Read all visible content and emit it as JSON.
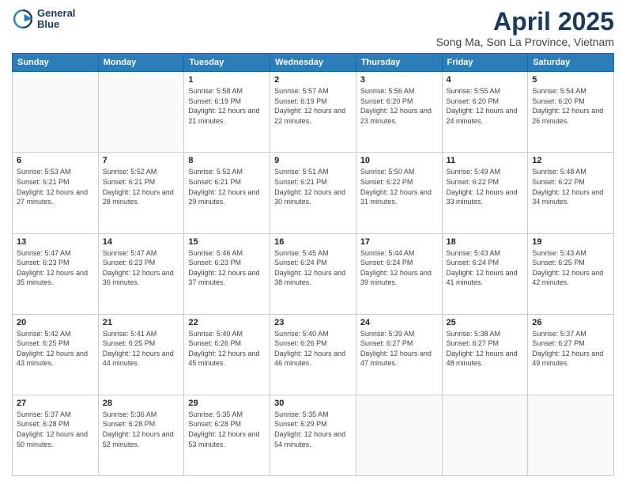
{
  "header": {
    "logo_line1": "General",
    "logo_line2": "Blue",
    "title": "April 2025",
    "subtitle": "Song Ma, Son La Province, Vietnam"
  },
  "days_of_week": [
    "Sunday",
    "Monday",
    "Tuesday",
    "Wednesday",
    "Thursday",
    "Friday",
    "Saturday"
  ],
  "weeks": [
    [
      {
        "num": "",
        "detail": ""
      },
      {
        "num": "",
        "detail": ""
      },
      {
        "num": "1",
        "detail": "Sunrise: 5:58 AM\nSunset: 6:19 PM\nDaylight: 12 hours and 21 minutes."
      },
      {
        "num": "2",
        "detail": "Sunrise: 5:57 AM\nSunset: 6:19 PM\nDaylight: 12 hours and 22 minutes."
      },
      {
        "num": "3",
        "detail": "Sunrise: 5:56 AM\nSunset: 6:20 PM\nDaylight: 12 hours and 23 minutes."
      },
      {
        "num": "4",
        "detail": "Sunrise: 5:55 AM\nSunset: 6:20 PM\nDaylight: 12 hours and 24 minutes."
      },
      {
        "num": "5",
        "detail": "Sunrise: 5:54 AM\nSunset: 6:20 PM\nDaylight: 12 hours and 26 minutes."
      }
    ],
    [
      {
        "num": "6",
        "detail": "Sunrise: 5:53 AM\nSunset: 6:21 PM\nDaylight: 12 hours and 27 minutes."
      },
      {
        "num": "7",
        "detail": "Sunrise: 5:52 AM\nSunset: 6:21 PM\nDaylight: 12 hours and 28 minutes."
      },
      {
        "num": "8",
        "detail": "Sunrise: 5:52 AM\nSunset: 6:21 PM\nDaylight: 12 hours and 29 minutes."
      },
      {
        "num": "9",
        "detail": "Sunrise: 5:51 AM\nSunset: 6:21 PM\nDaylight: 12 hours and 30 minutes."
      },
      {
        "num": "10",
        "detail": "Sunrise: 5:50 AM\nSunset: 6:22 PM\nDaylight: 12 hours and 31 minutes."
      },
      {
        "num": "11",
        "detail": "Sunrise: 5:49 AM\nSunset: 6:22 PM\nDaylight: 12 hours and 33 minutes."
      },
      {
        "num": "12",
        "detail": "Sunrise: 5:48 AM\nSunset: 6:22 PM\nDaylight: 12 hours and 34 minutes."
      }
    ],
    [
      {
        "num": "13",
        "detail": "Sunrise: 5:47 AM\nSunset: 6:23 PM\nDaylight: 12 hours and 35 minutes."
      },
      {
        "num": "14",
        "detail": "Sunrise: 5:47 AM\nSunset: 6:23 PM\nDaylight: 12 hours and 36 minutes."
      },
      {
        "num": "15",
        "detail": "Sunrise: 5:46 AM\nSunset: 6:23 PM\nDaylight: 12 hours and 37 minutes."
      },
      {
        "num": "16",
        "detail": "Sunrise: 5:45 AM\nSunset: 6:24 PM\nDaylight: 12 hours and 38 minutes."
      },
      {
        "num": "17",
        "detail": "Sunrise: 5:44 AM\nSunset: 6:24 PM\nDaylight: 12 hours and 39 minutes."
      },
      {
        "num": "18",
        "detail": "Sunrise: 5:43 AM\nSunset: 6:24 PM\nDaylight: 12 hours and 41 minutes."
      },
      {
        "num": "19",
        "detail": "Sunrise: 5:43 AM\nSunset: 6:25 PM\nDaylight: 12 hours and 42 minutes."
      }
    ],
    [
      {
        "num": "20",
        "detail": "Sunrise: 5:42 AM\nSunset: 6:25 PM\nDaylight: 12 hours and 43 minutes."
      },
      {
        "num": "21",
        "detail": "Sunrise: 5:41 AM\nSunset: 6:25 PM\nDaylight: 12 hours and 44 minutes."
      },
      {
        "num": "22",
        "detail": "Sunrise: 5:40 AM\nSunset: 6:26 PM\nDaylight: 12 hours and 45 minutes."
      },
      {
        "num": "23",
        "detail": "Sunrise: 5:40 AM\nSunset: 6:26 PM\nDaylight: 12 hours and 46 minutes."
      },
      {
        "num": "24",
        "detail": "Sunrise: 5:39 AM\nSunset: 6:27 PM\nDaylight: 12 hours and 47 minutes."
      },
      {
        "num": "25",
        "detail": "Sunrise: 5:38 AM\nSunset: 6:27 PM\nDaylight: 12 hours and 48 minutes."
      },
      {
        "num": "26",
        "detail": "Sunrise: 5:37 AM\nSunset: 6:27 PM\nDaylight: 12 hours and 49 minutes."
      }
    ],
    [
      {
        "num": "27",
        "detail": "Sunrise: 5:37 AM\nSunset: 6:28 PM\nDaylight: 12 hours and 50 minutes."
      },
      {
        "num": "28",
        "detail": "Sunrise: 5:36 AM\nSunset: 6:28 PM\nDaylight: 12 hours and 52 minutes."
      },
      {
        "num": "29",
        "detail": "Sunrise: 5:35 AM\nSunset: 6:28 PM\nDaylight: 12 hours and 53 minutes."
      },
      {
        "num": "30",
        "detail": "Sunrise: 5:35 AM\nSunset: 6:29 PM\nDaylight: 12 hours and 54 minutes."
      },
      {
        "num": "",
        "detail": ""
      },
      {
        "num": "",
        "detail": ""
      },
      {
        "num": "",
        "detail": ""
      }
    ]
  ]
}
